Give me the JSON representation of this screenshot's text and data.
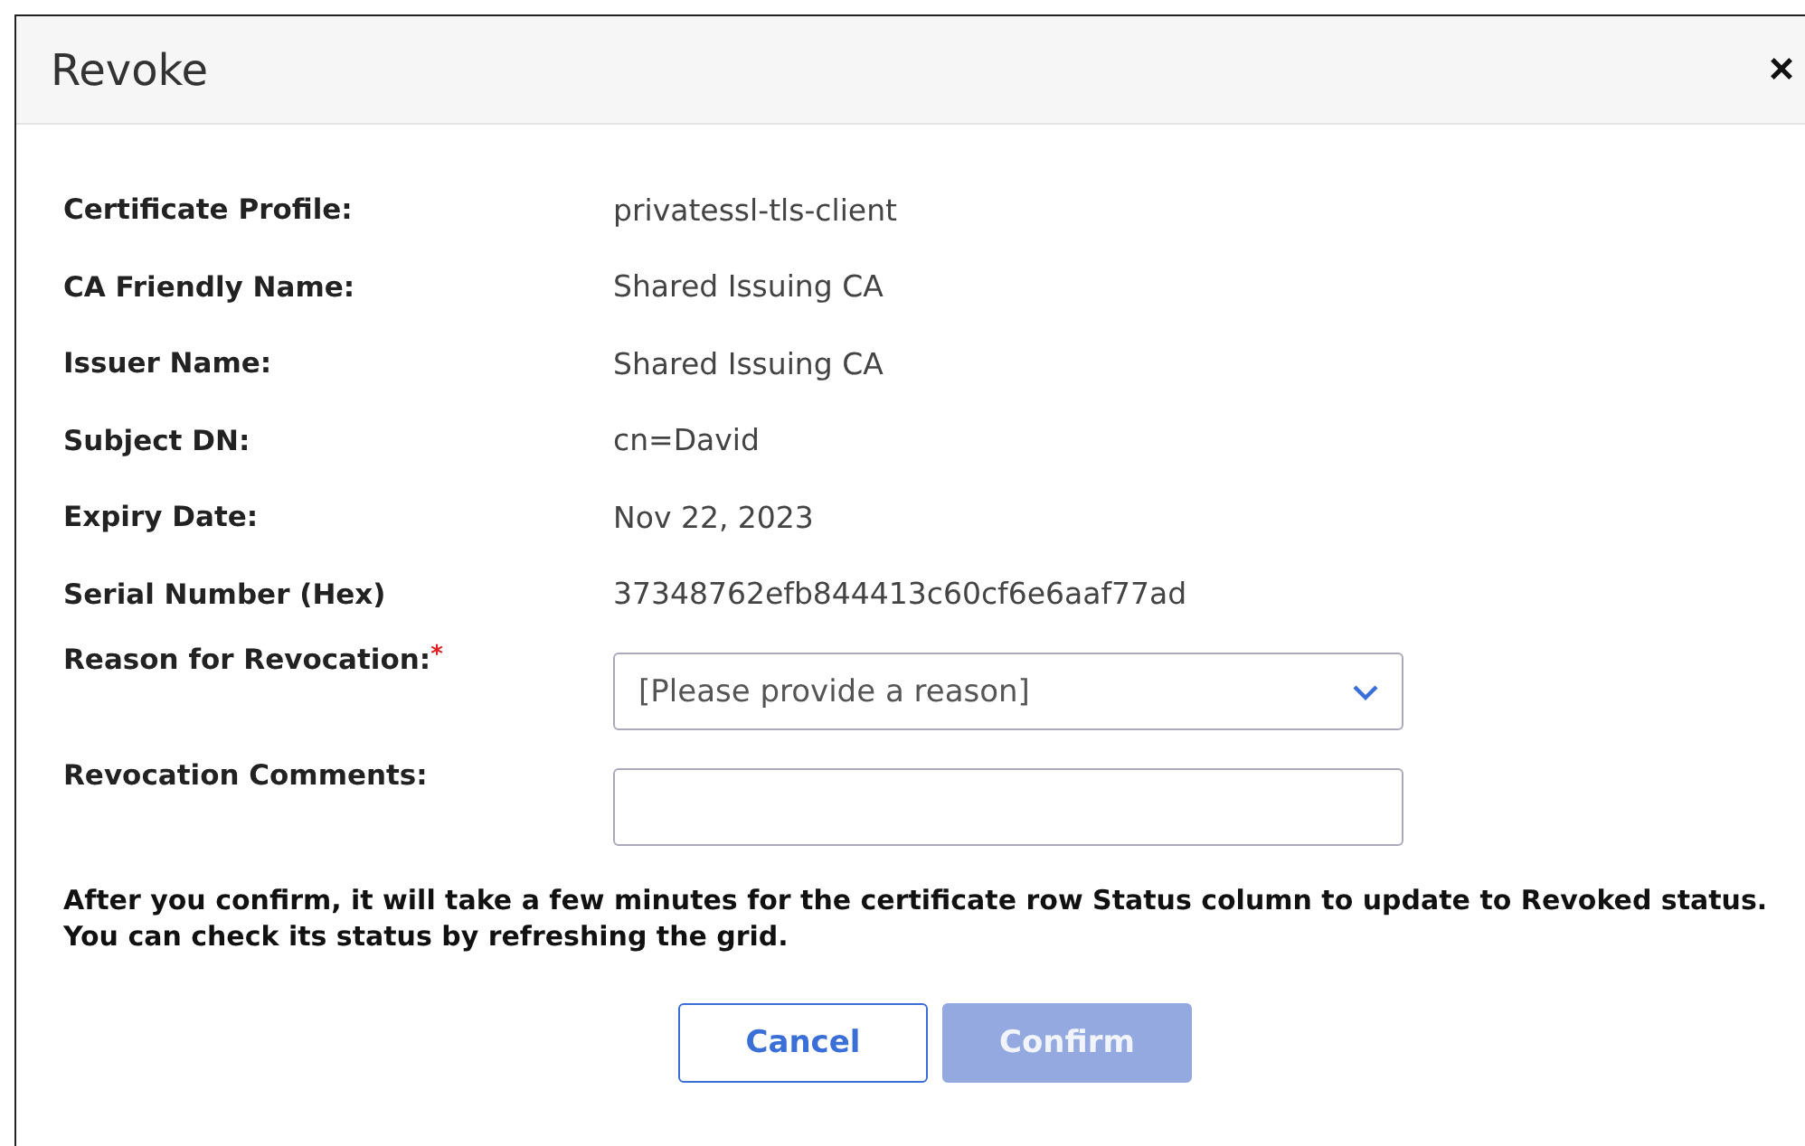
{
  "dialog": {
    "title": "Revoke",
    "close": "×"
  },
  "fields": [
    {
      "label": "Certificate Profile:",
      "value": "privatessl-tls-client"
    },
    {
      "label": "CA Friendly Name:",
      "value": "Shared Issuing CA"
    },
    {
      "label": "Issuer Name:",
      "value": "Shared Issuing CA"
    },
    {
      "label": "Subject DN:",
      "value": "cn=David"
    },
    {
      "label": "Expiry Date:",
      "value": "Nov 22, 2023"
    },
    {
      "label": "Serial Number (Hex)",
      "value": "37348762efb844413c60cf6e6aaf77ad"
    }
  ],
  "reason": {
    "label": "Reason for Revocation:",
    "required_mark": "*",
    "placeholder": "[Please provide a reason]"
  },
  "comments": {
    "label": "Revocation Comments:"
  },
  "notice": "After you confirm, it will take a few minutes for the certificate row Status column to update to Revoked status. You can check its status by refreshing the grid.",
  "buttons": [
    {
      "label": "Cancel",
      "kind": "secondary",
      "disabled": false
    },
    {
      "label": "Confirm",
      "kind": "primary",
      "disabled": true
    }
  ]
}
